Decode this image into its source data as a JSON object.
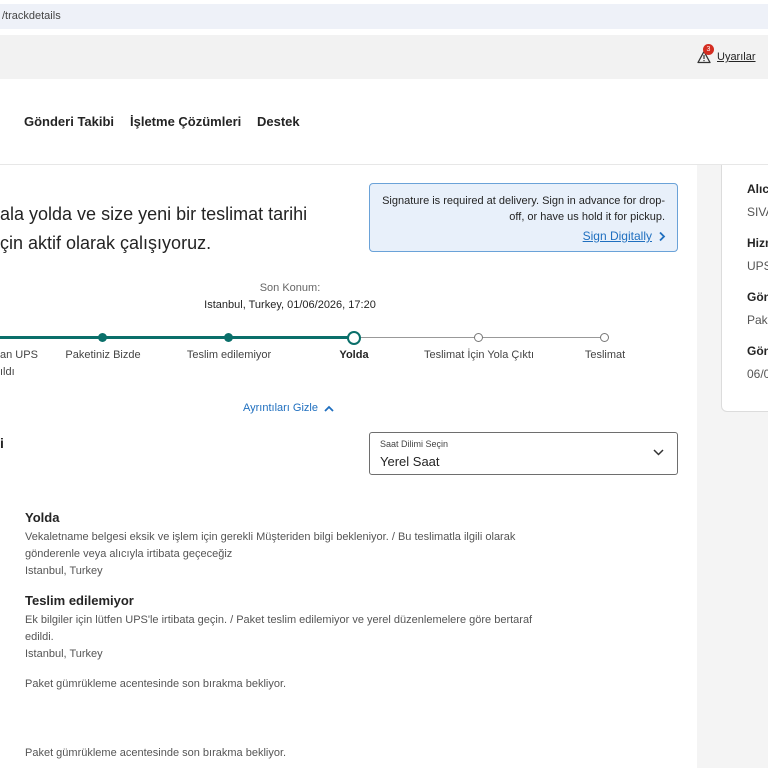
{
  "browser": {
    "url": "/trackdetails"
  },
  "topbar": {
    "alerts_label": "Uyarılar",
    "alerts_count": "3"
  },
  "nav": {
    "items": [
      "Gönderi Takibi",
      "İşletme Çözümleri",
      "Destek"
    ]
  },
  "headline": {
    "line1": "ala yolda ve size yeni bir teslimat tarihi",
    "line2": "çin aktif olarak çalışıyoruz."
  },
  "notice": {
    "line1": "Signature is required at delivery. Sign in advance for drop-",
    "line2": "off, or have us hold it for pickup.",
    "link_label": "Sign Digitally"
  },
  "last_location": {
    "label": "Son Konum:",
    "value": "Istanbul, Turkey, 01/06/2026, 17:20"
  },
  "progress": {
    "steps": [
      {
        "line1": "an UPS",
        "line2": "ıldı",
        "state": "done"
      },
      {
        "line1": "Paketiniz Bizde",
        "state": "done"
      },
      {
        "line1": "Teslim edilemiyor",
        "state": "done"
      },
      {
        "line1": "Yolda",
        "state": "current"
      },
      {
        "line1": "Teslimat İçin Yola Çıktı",
        "state": "pending"
      },
      {
        "line1": "Teslimat",
        "state": "pending"
      }
    ]
  },
  "details_toggle": {
    "label": "Ayrıntıları Gizle"
  },
  "section_cut_title": "i",
  "timezone": {
    "caption": "Saat Dilimi Seçin",
    "value": "Yerel Saat"
  },
  "events": [
    {
      "title": "Yolda",
      "line1": "Vekaletname belgesi eksik ve işlem için gerekli Müşteriden bilgi bekleniyor. / Bu teslimatla ilgili olarak",
      "line2": "gönderenle veya alıcıyla irtibata geçeceğiz",
      "location": "Istanbul, Turkey"
    },
    {
      "title": "Teslim edilemiyor",
      "line1": "Ek bilgiler için lütfen UPS'le irtibata geçin. / Paket teslim edilemiyor ve yerel düzenlemelere göre bertaraf",
      "line2": "edildi.",
      "location": "Istanbul, Turkey"
    },
    {
      "line1": "Paket gümrükleme acentesinde son bırakma bekliyor."
    },
    {
      "line1": "Paket gümrükleme acentesinde son bırakma bekliyor."
    }
  ],
  "info_card": {
    "items": [
      {
        "label": "Alıcı",
        "value": "SIVA"
      },
      {
        "label": "Hizm",
        "value": "UPS"
      },
      {
        "label": "Gön",
        "value": "Pak"
      },
      {
        "label": "Gön",
        "value": "06/0"
      }
    ]
  },
  "colors": {
    "accent_teal": "#0a6f6a",
    "link_blue": "#1f6fbf",
    "notice_bg": "#e8f0fa",
    "badge_red": "#d42d21"
  }
}
